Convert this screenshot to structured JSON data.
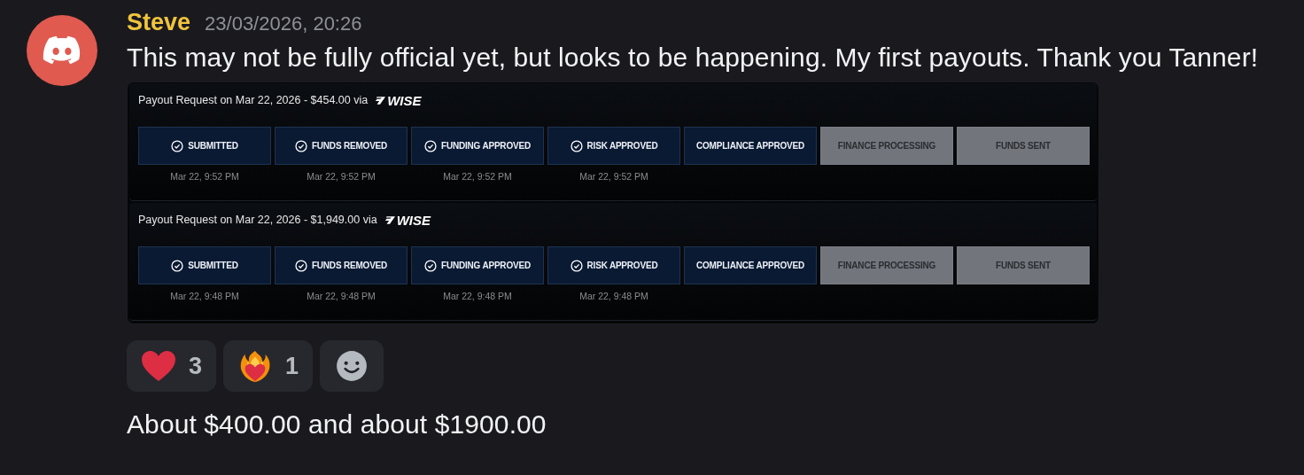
{
  "message": {
    "author": "Steve",
    "timestamp": "23/03/2026, 20:26",
    "text": "This may not be fully official yet, but looks to be happening. My first payouts. Thank you Tanner!"
  },
  "attachment": {
    "requests": [
      {
        "title": "Payout Request on Mar 22, 2026 - $454.00 via",
        "provider": "WISE",
        "steps": [
          {
            "label": "SUBMITTED",
            "completed": true,
            "icon": true,
            "time": "Mar 22, 9:52 PM"
          },
          {
            "label": "FUNDS REMOVED",
            "completed": true,
            "icon": true,
            "time": "Mar 22, 9:52 PM"
          },
          {
            "label": "FUNDING APPROVED",
            "completed": true,
            "icon": true,
            "time": "Mar 22, 9:52 PM"
          },
          {
            "label": "RISK APPROVED",
            "completed": true,
            "icon": true,
            "time": "Mar 22, 9:52 PM"
          },
          {
            "label": "COMPLIANCE APPROVED",
            "completed": true,
            "icon": false
          },
          {
            "label": "FINANCE PROCESSING",
            "completed": false,
            "icon": false
          },
          {
            "label": "FUNDS SENT",
            "completed": false,
            "icon": false
          }
        ]
      },
      {
        "title": "Payout Request on Mar 22, 2026 - $1,949.00 via",
        "provider": "WISE",
        "steps": [
          {
            "label": "SUBMITTED",
            "completed": true,
            "icon": true,
            "time": "Mar 22, 9:48 PM"
          },
          {
            "label": "FUNDS REMOVED",
            "completed": true,
            "icon": true,
            "time": "Mar 22, 9:48 PM"
          },
          {
            "label": "FUNDING APPROVED",
            "completed": true,
            "icon": true,
            "time": "Mar 22, 9:48 PM"
          },
          {
            "label": "RISK APPROVED",
            "completed": true,
            "icon": true,
            "time": "Mar 22, 9:48 PM"
          },
          {
            "label": "COMPLIANCE APPROVED",
            "completed": true,
            "icon": false
          },
          {
            "label": "FINANCE PROCESSING",
            "completed": false,
            "icon": false
          },
          {
            "label": "FUNDS SENT",
            "completed": false,
            "icon": false
          }
        ]
      }
    ]
  },
  "reactions": [
    {
      "kind": "heart",
      "count": "3"
    },
    {
      "kind": "fire-heart",
      "count": "1"
    },
    {
      "kind": "add"
    }
  ],
  "followup": {
    "text": "About $400.00 and about $1900.00"
  }
}
